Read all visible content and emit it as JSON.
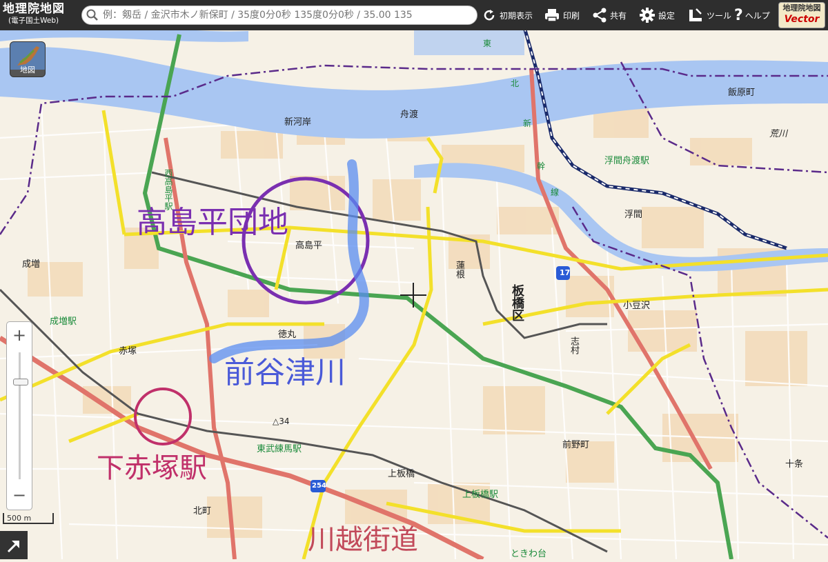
{
  "app": {
    "title": "地理院地図",
    "subtitle": "(電子国土Web)"
  },
  "search": {
    "placeholder": "例：剱岳 / 金沢市木ノ新保町 / 35度0分0秒 135度0分0秒 / 35.00 135"
  },
  "toolbar": {
    "reset_label": "初期表示",
    "print_label": "印刷",
    "share_label": "共有",
    "settings_label": "設定",
    "tools_label": "ツール",
    "help_label": "ヘルプ"
  },
  "vector_badge": {
    "line1": "地理院地図",
    "line2": "Vector"
  },
  "layer_button": {
    "label": "地図"
  },
  "scale": {
    "label": "500 m"
  },
  "map_labels": {
    "shinkawagishi": "新河岸",
    "funado": "舟渡",
    "iiharacho": "飯原町",
    "arakawa": "荒川",
    "ukimafunado_station": "浮間舟渡駅",
    "ukima": "浮間",
    "takashimadaira": "高島平",
    "nishidaishimadaira_station": "西高島平駅",
    "narimasu": "成増",
    "narimasu_station": "成増駅",
    "hasune": "蓮根",
    "itabashi_ku": "板橋区",
    "azusawa": "小豆沢",
    "tokumaru": "徳丸",
    "akatsuka": "赤塚",
    "shimura": "志村",
    "maenocho": "前野町",
    "tobu_nerima_station": "東武練馬駅",
    "kamiitabashi": "上板橋",
    "kamiitabashi_station": "上板橋駅",
    "kitamachi": "北町",
    "jujo": "十条",
    "tokiwadai": "ときわ台",
    "elevation": "△34",
    "route17": "17",
    "route254": "254",
    "tohoku_line_1": "東",
    "tohoku_line_2": "北",
    "tohoku_line_3": "新",
    "tohoku_line_4": "幹",
    "tohoku_line_5": "線"
  },
  "annotations": {
    "danchi": "高島平団地",
    "river": "前谷津川",
    "station": "下赤塚駅",
    "kaido": "川越街道"
  },
  "colors": {
    "annotation_purple": "#7a2fb0",
    "annotation_blue": "#4a5ad8",
    "annotation_crimson": "#c0306a",
    "annotation_red": "#c24a5a",
    "river_highlight": "#5a8cf0"
  }
}
